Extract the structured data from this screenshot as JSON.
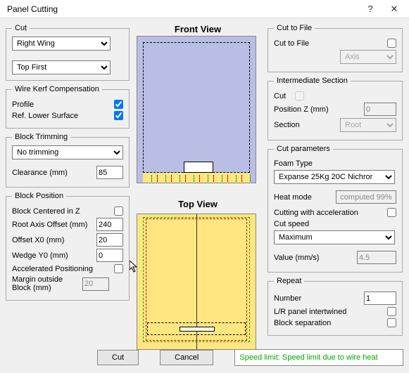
{
  "window": {
    "title": "Panel Cutting"
  },
  "cut": {
    "legend": "Cut",
    "wing": "Right Wing",
    "order": "Top First"
  },
  "kerf": {
    "legend": "Wire Kerf Compensation",
    "profile_label": "Profile",
    "profile_checked": true,
    "ref_lower_label": "Ref. Lower Surface",
    "ref_lower_checked": true
  },
  "block_trim": {
    "legend": "Block Trimming",
    "mode": "No trimming",
    "clearance_label": "Clearance (mm)",
    "clearance_value": "85"
  },
  "block_pos": {
    "legend": "Block Position",
    "centered_label": "Block Centered in Z",
    "centered_checked": false,
    "root_axis_label": "Root Axis Offset (mm)",
    "root_axis_value": "240",
    "offset_x0_label": "Offset X0 (mm)",
    "offset_x0_value": "20",
    "wedge_y0_label": "Wedge Y0 (mm)",
    "wedge_y0_value": "0",
    "accel_label": "Accelerated Positioning",
    "accel_checked": false,
    "margin_label": "Margin outside Block (mm)",
    "margin_value": "20"
  },
  "views": {
    "front_label": "Front View",
    "top_label": "Top View"
  },
  "cut_to_file": {
    "legend": "Cut to File",
    "label": "Cut to File",
    "checked": false,
    "axis_option": "Axis"
  },
  "intermediate": {
    "legend": "Intermediate Section",
    "cut_label": "Cut",
    "cut_checked": false,
    "posz_label": "Position Z (mm)",
    "posz_value": "0",
    "section_label": "Section",
    "section_value": "Root"
  },
  "cut_params": {
    "legend": "Cut parameters",
    "foam_label": "Foam Type",
    "foam_value": "Expanse 25Kg 20C Nichror",
    "heat_label": "Heat mode",
    "heat_value": "computed 99%",
    "accel_label": "Cutting with acceleration",
    "accel_checked": false,
    "speed_label": "Cut speed",
    "speed_value": "Maximum",
    "value_label": "Value (mm/s)",
    "value_value": "4.5"
  },
  "repeat": {
    "legend": "Repeat",
    "number_label": "Number",
    "number_value": "1",
    "lr_label": "L/R panel intertwined",
    "lr_checked": false,
    "sep_label": "Block separation",
    "sep_checked": false
  },
  "buttons": {
    "cut": "Cut",
    "cancel": "Cancel"
  },
  "status": "Speed limit: Speed limit due to wire heat"
}
